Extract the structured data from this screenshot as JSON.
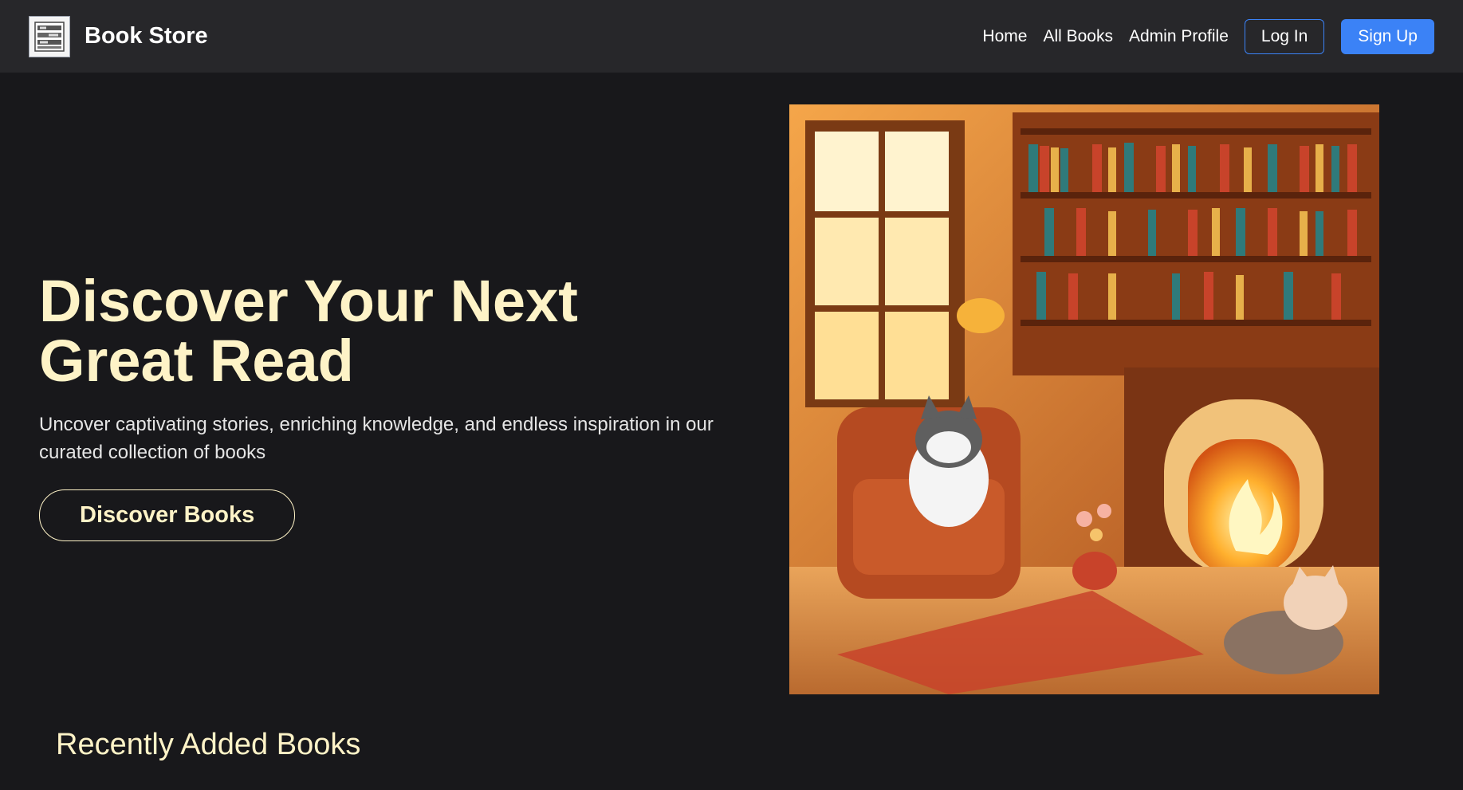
{
  "header": {
    "brand_title": "Book Store",
    "nav": [
      "Home",
      "All Books",
      "Admin Profile"
    ],
    "login_label": "Log In",
    "signup_label": "Sign Up"
  },
  "hero": {
    "title": "Discover Your Next Great Read",
    "subtitle": "Uncover captivating stories, enriching knowledge, and endless inspiration in our curated collection of books",
    "cta_label": "Discover Books"
  },
  "sections": {
    "recent_title": "Recently Added Books"
  },
  "colors": {
    "background": "#18181b",
    "navbar": "#27272a",
    "accent": "#3b82f6",
    "cream": "#fef3c7"
  },
  "icons": {
    "logo": "books-logo-icon"
  }
}
